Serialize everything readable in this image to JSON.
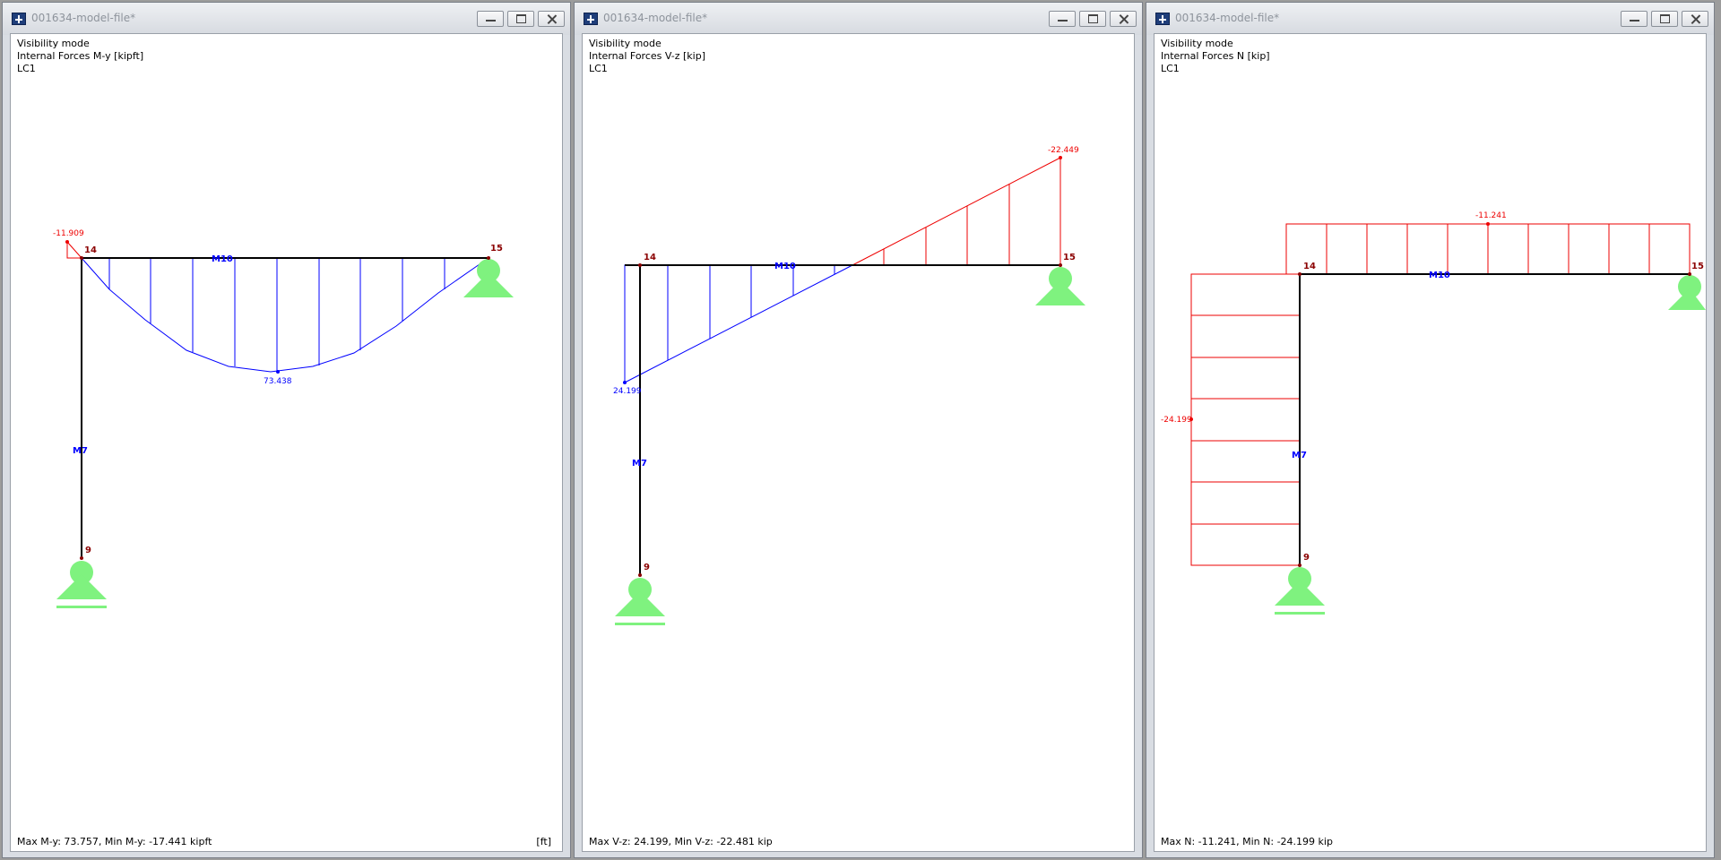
{
  "colors": {
    "positive_diagram": "#0000ff",
    "negative_diagram": "#ee0000",
    "support": "#7ff27f",
    "member": "#000000",
    "node_label": "#8b0000",
    "member_label": "#0000ff"
  },
  "windows": [
    {
      "title": "001634-model-file*",
      "info": {
        "mode": "Visibility mode",
        "result": "Internal Forces M-y [kipft]",
        "load_case": "LC1"
      },
      "labels": {
        "node_14": "14",
        "node_15": "15",
        "node_9": "9",
        "member_m10": "M10",
        "member_m7": "M7",
        "value_min": "-11.909",
        "value_max": "73.438"
      },
      "footer": "Max M-y: 73.757, Min M-y: -17.441 kipft",
      "footer_unit": "[ft]"
    },
    {
      "title": "001634-model-file*",
      "info": {
        "mode": "Visibility mode",
        "result": "Internal Forces V-z [kip]",
        "load_case": "LC1"
      },
      "labels": {
        "node_14": "14",
        "node_15": "15",
        "node_9": "9",
        "member_m10": "M10",
        "member_m7": "M7",
        "value_min": "-22.449",
        "value_max": "24.199"
      },
      "footer": "Max V-z: 24.199, Min V-z: -22.481 kip"
    },
    {
      "title": "001634-model-file*",
      "info": {
        "mode": "Visibility mode",
        "result": "Internal Forces N [kip]",
        "load_case": "LC1"
      },
      "labels": {
        "node_14": "14",
        "node_15": "15",
        "node_9": "9",
        "member_m10": "M10",
        "member_m7": "M7",
        "value_beam": "-11.241",
        "value_column": "-24.199"
      },
      "footer": "Max N: -11.241, Min N: -24.199 kip"
    }
  ]
}
